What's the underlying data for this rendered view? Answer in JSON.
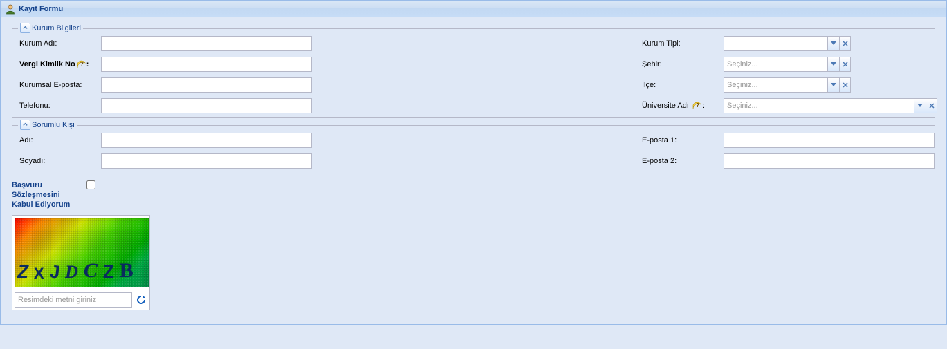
{
  "panel": {
    "title": "Kayıt Formu"
  },
  "fieldsets": {
    "kurum": {
      "legend": "Kurum Bilgileri",
      "labels": {
        "kurum_adi": "Kurum Adı:",
        "vergi_kimlik": "Vergi Kimlik No",
        "kurumsal_eposta": "Kurumsal E-posta:",
        "telefon": "Telefonu:",
        "kurum_tipi": "Kurum Tipi:",
        "sehir": "Şehir:",
        "ilce": "İlçe:",
        "universite": "Üniversite Adı"
      },
      "values": {
        "kurum_adi": "",
        "vergi_kimlik": "",
        "kurumsal_eposta": "",
        "telefon": "",
        "kurum_tipi": "",
        "sehir": "Seçiniz...",
        "ilce": "Seçiniz...",
        "universite": "Seçiniz..."
      }
    },
    "sorumlu": {
      "legend": "Sorumlu Kişi",
      "labels": {
        "adi": "Adı:",
        "soyadi": "Soyadı:",
        "eposta1": "E-posta 1:",
        "eposta2": "E-posta 2:"
      },
      "values": {
        "adi": "",
        "soyadi": "",
        "eposta1": "",
        "eposta2": ""
      }
    }
  },
  "agreement": {
    "link_text": "Başvuru Sözleşmesini Kabul Ediyorum",
    "checked": false
  },
  "captcha": {
    "chars": [
      "Z",
      "X",
      "J",
      "D",
      "C",
      "Z",
      "B"
    ],
    "placeholder": "Resimdeki metni giriniz",
    "value": ""
  },
  "combo_placeholder": "Seçiniz...",
  "colors": {
    "accent": "#15428b",
    "border": "#99bbe8",
    "field_border": "#b5b8c8",
    "bg": "#dfe8f6"
  }
}
